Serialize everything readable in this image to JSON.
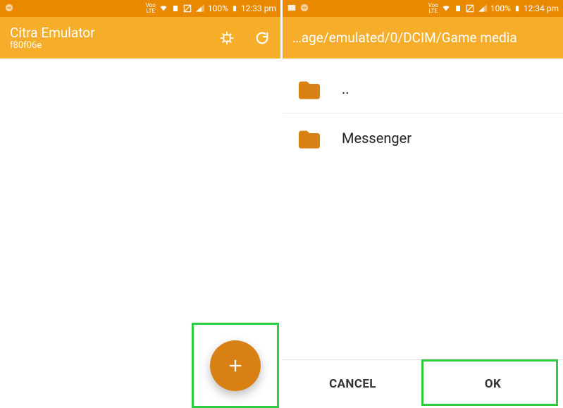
{
  "left": {
    "status": {
      "battery": "100%",
      "time": "12:33 pm"
    },
    "title": "Citra Emulator",
    "subtitle": "f80f06e"
  },
  "right": {
    "status": {
      "battery": "100%",
      "time": "12:34 pm"
    },
    "path": "…age/emulated/0/DCIM/Game media",
    "rows": [
      {
        "label": ".."
      },
      {
        "label": "Messenger"
      }
    ],
    "cancel": "CANCEL",
    "ok": "OK"
  }
}
